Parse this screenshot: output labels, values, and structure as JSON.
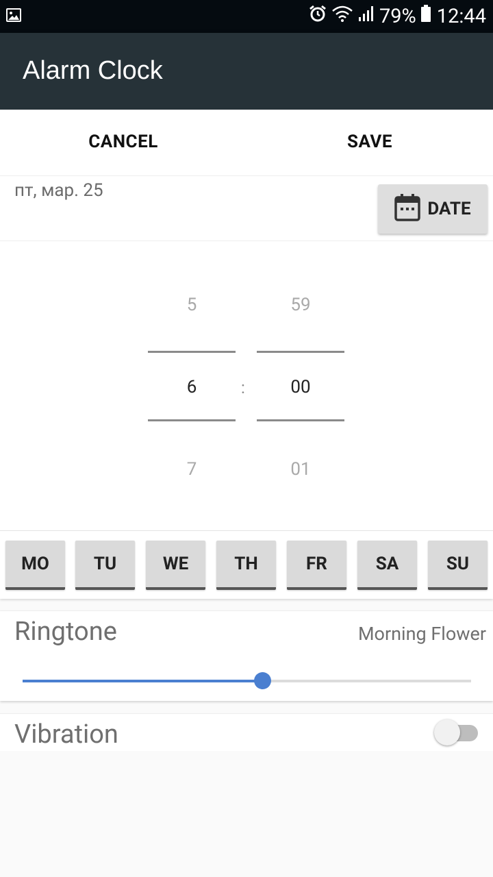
{
  "status_bar": {
    "battery": "79%",
    "time": "12:44",
    "icons": [
      "image-notification-icon",
      "alarm-icon",
      "wifi-icon",
      "signal-icon",
      "battery-icon"
    ]
  },
  "app_bar": {
    "title": "Alarm Clock",
    "color": "#263238"
  },
  "actions": {
    "cancel_label": "CANCEL",
    "save_label": "SAVE"
  },
  "date": {
    "value": "пт, мар. 25",
    "button_label": "DATE",
    "button_icon": "calendar-icon"
  },
  "time_picker": {
    "hours": {
      "prev": "5",
      "current": "6",
      "next": "7"
    },
    "separator": ":",
    "minutes": {
      "prev": "59",
      "current": "00",
      "next": "01"
    }
  },
  "days": [
    {
      "label": "MO"
    },
    {
      "label": "TU"
    },
    {
      "label": "WE"
    },
    {
      "label": "TH"
    },
    {
      "label": "FR"
    },
    {
      "label": "SA"
    },
    {
      "label": "SU"
    }
  ],
  "ringtone": {
    "label": "Ringtone",
    "value": "Morning Flower",
    "volume_fraction": 0.535,
    "accent": "#4a7fd0"
  },
  "vibration": {
    "label": "Vibration",
    "enabled": false
  }
}
